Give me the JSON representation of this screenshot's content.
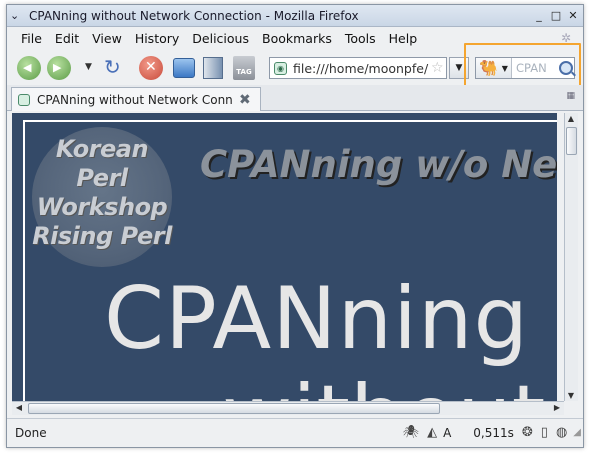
{
  "window": {
    "title": "CPANning without Network Connection - Mozilla Firefox",
    "controls": {
      "minimize": "_",
      "maximize": "□",
      "close": "✕"
    }
  },
  "menubar": {
    "items": [
      "File",
      "Edit",
      "View",
      "History",
      "Delicious",
      "Bookmarks",
      "Tools",
      "Help"
    ]
  },
  "toolbar": {
    "url": "file:///home/moonpfe/",
    "search_placeholder": "CPAN"
  },
  "tabs": [
    {
      "label": "CPANning without Network Conn..."
    }
  ],
  "slide": {
    "logo_lines": [
      "Korean",
      "Perl",
      "Workshop",
      "Rising Perl"
    ],
    "subtitle": "CPANning w/o Ne",
    "title_line1": "CPANning",
    "title_line2": "without"
  },
  "statusbar": {
    "text": "Done",
    "lang": "A",
    "timing": "0,511s"
  },
  "colors": {
    "slide_background": "#344a68",
    "highlight": "#f4a530"
  }
}
